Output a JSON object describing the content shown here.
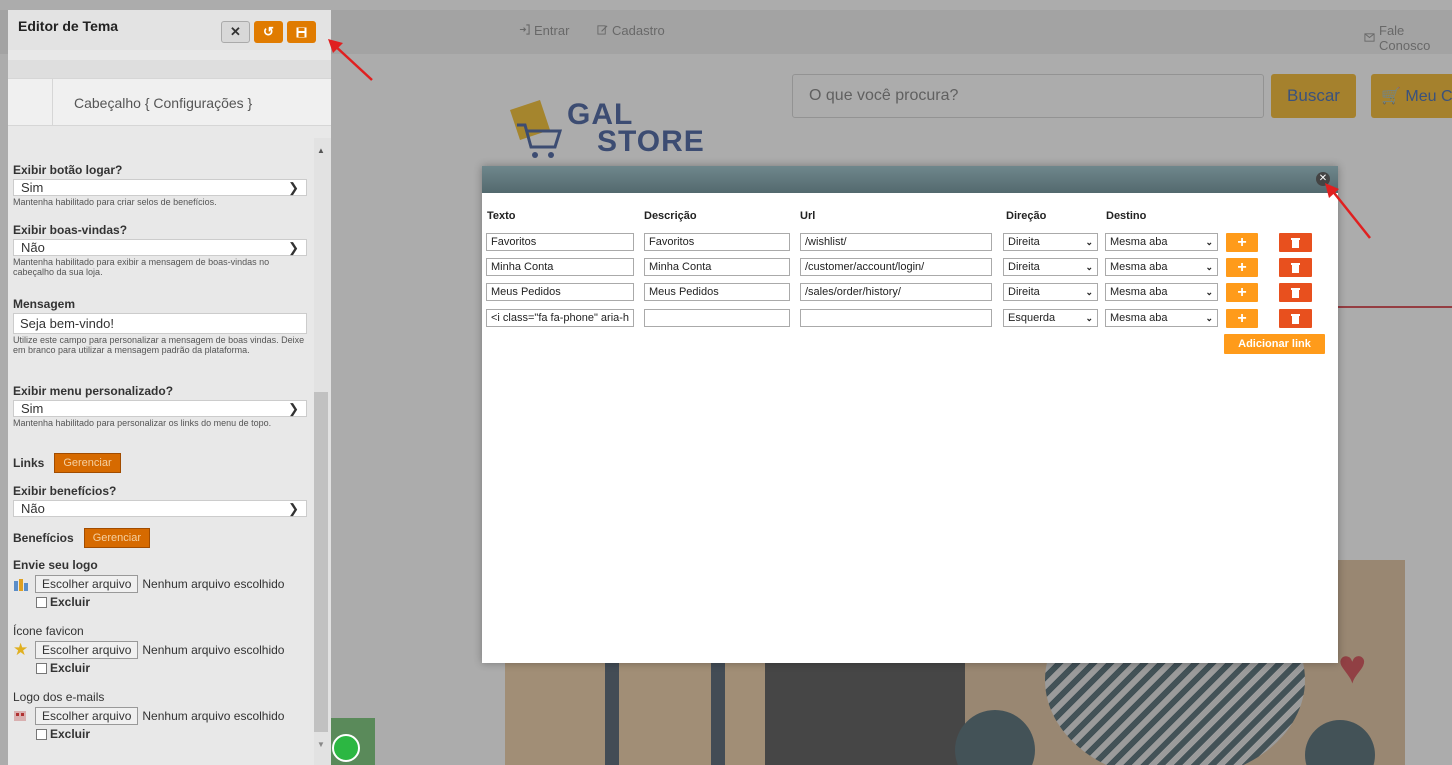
{
  "site": {
    "top_links": {
      "login": "Entrar",
      "register": "Cadastro",
      "contact": "Fale Conosco"
    },
    "search": {
      "placeholder": "O que você procura?",
      "button": "Buscar"
    },
    "cart": {
      "label": "Meu C"
    },
    "logo": {
      "line1": "GAL",
      "line2": "STORE"
    }
  },
  "editor": {
    "title": "Editor de Tema",
    "section_tab": "Cabeçalho { Configurações }",
    "fields": {
      "login_button": {
        "label": "Exibir botão logar?",
        "value": "Sim",
        "help": "Mantenha habilitado para criar selos de benefícios."
      },
      "welcome": {
        "label": "Exibir boas-vindas?",
        "value": "Não",
        "help": "Mantenha habilitado para exibir a mensagem de boas-vindas no cabeçalho da sua loja."
      },
      "message": {
        "label": "Mensagem",
        "value": "Seja bem-vindo!",
        "help": "Utilize este campo para personalizar a mensagem de boas vindas. Deixe em branco para utilizar a mensagem padrão da plataforma."
      },
      "custom_menu": {
        "label": "Exibir menu personalizado?",
        "value": "Sim",
        "help": "Mantenha habilitado para personalizar os links do menu de topo."
      },
      "links": {
        "label": "Links",
        "button": "Gerenciar"
      },
      "benefits_show": {
        "label": "Exibir benefícios?",
        "value": "Não"
      },
      "benefits": {
        "label": "Benefícios",
        "button": "Gerenciar"
      },
      "logo_upload": {
        "label": "Envie seu logo",
        "button": "Escolher arquivo",
        "status": "Nenhum arquivo escolhido",
        "delete": "Excluir"
      },
      "favicon_upload": {
        "label": "Ícone favicon",
        "button": "Escolher arquivo",
        "status": "Nenhum arquivo escolhido",
        "delete": "Excluir"
      },
      "email_logo_upload": {
        "label": "Logo dos e-mails",
        "button": "Escolher arquivo",
        "status": "Nenhum arquivo escolhido",
        "delete": "Excluir"
      }
    }
  },
  "modal": {
    "columns": [
      "Texto",
      "Descrição",
      "Url",
      "Direção",
      "Destino"
    ],
    "rows": [
      {
        "text": "Favoritos",
        "description": "Favoritos",
        "url": "/wishlist/",
        "direction": "Direita",
        "target": "Mesma aba"
      },
      {
        "text": "Minha Conta",
        "description": "Minha Conta",
        "url": "/customer/account/login/",
        "direction": "Direita",
        "target": "Mesma aba"
      },
      {
        "text": "Meus Pedidos",
        "description": "Meus Pedidos",
        "url": "/sales/order/history/",
        "direction": "Direita",
        "target": "Mesma aba"
      },
      {
        "text": "<i class=\"fa fa-phone\" aria-h",
        "description": "",
        "url": "",
        "direction": "Esquerda",
        "target": "Mesma aba"
      }
    ],
    "add_button": "Adicionar link"
  },
  "colors": {
    "accent": "#e07b00",
    "add_button": "#ff9b1a",
    "delete_button": "#e8501e",
    "brand_blue": "#1f3f8a",
    "annotation_arrow": "#e02020"
  }
}
